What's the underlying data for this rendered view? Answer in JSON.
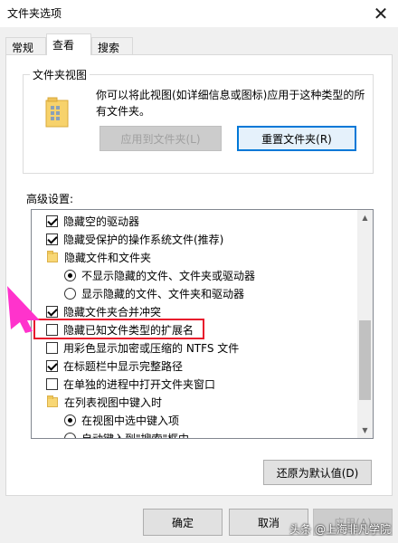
{
  "window": {
    "title": "文件夹选项",
    "close_glyph": "✕"
  },
  "tabs": [
    {
      "label": "常规"
    },
    {
      "label": "查看"
    },
    {
      "label": "搜索"
    }
  ],
  "folder_view": {
    "title": "文件夹视图",
    "description": "你可以将此视图(如详细信息或图标)应用于这种类型的所有文件夹。",
    "apply_button": "应用到文件夹(L)",
    "reset_button": "重置文件夹(R)"
  },
  "advanced": {
    "label": "高级设置:",
    "items": [
      {
        "type": "checkbox",
        "checked": true,
        "label": "隐藏空的驱动器"
      },
      {
        "type": "checkbox",
        "checked": true,
        "label": "隐藏受保护的操作系统文件(推荐)"
      },
      {
        "type": "folder",
        "label": "隐藏文件和文件夹"
      },
      {
        "type": "radio",
        "checked": true,
        "label": "不显示隐藏的文件、文件夹或驱动器"
      },
      {
        "type": "radio",
        "checked": false,
        "label": "显示隐藏的文件、文件夹和驱动器"
      },
      {
        "type": "checkbox",
        "checked": true,
        "label": "隐藏文件夹合并冲突"
      },
      {
        "type": "checkbox",
        "checked": false,
        "label": "隐藏已知文件类型的扩展名"
      },
      {
        "type": "checkbox",
        "checked": false,
        "label": "用彩色显示加密或压缩的 NTFS 文件"
      },
      {
        "type": "checkbox",
        "checked": true,
        "label": "在标题栏中显示完整路径"
      },
      {
        "type": "checkbox",
        "checked": false,
        "label": "在单独的进程中打开文件夹窗口"
      },
      {
        "type": "folder",
        "label": "在列表视图中键入时"
      },
      {
        "type": "radio",
        "checked": true,
        "label": "在视图中选中键入项"
      },
      {
        "type": "radio",
        "checked": false,
        "label": "自动键入到\"搜索\"框中"
      }
    ],
    "restore_button": "还原为默认值(D)"
  },
  "footer": {
    "ok": "确定",
    "cancel": "取消",
    "apply": "应用(A)"
  },
  "watermark": "头条 @上海非凡学院",
  "colors": {
    "highlight": "#e8192c",
    "arrow": "#ff33cc",
    "focus": "#0078d7"
  }
}
